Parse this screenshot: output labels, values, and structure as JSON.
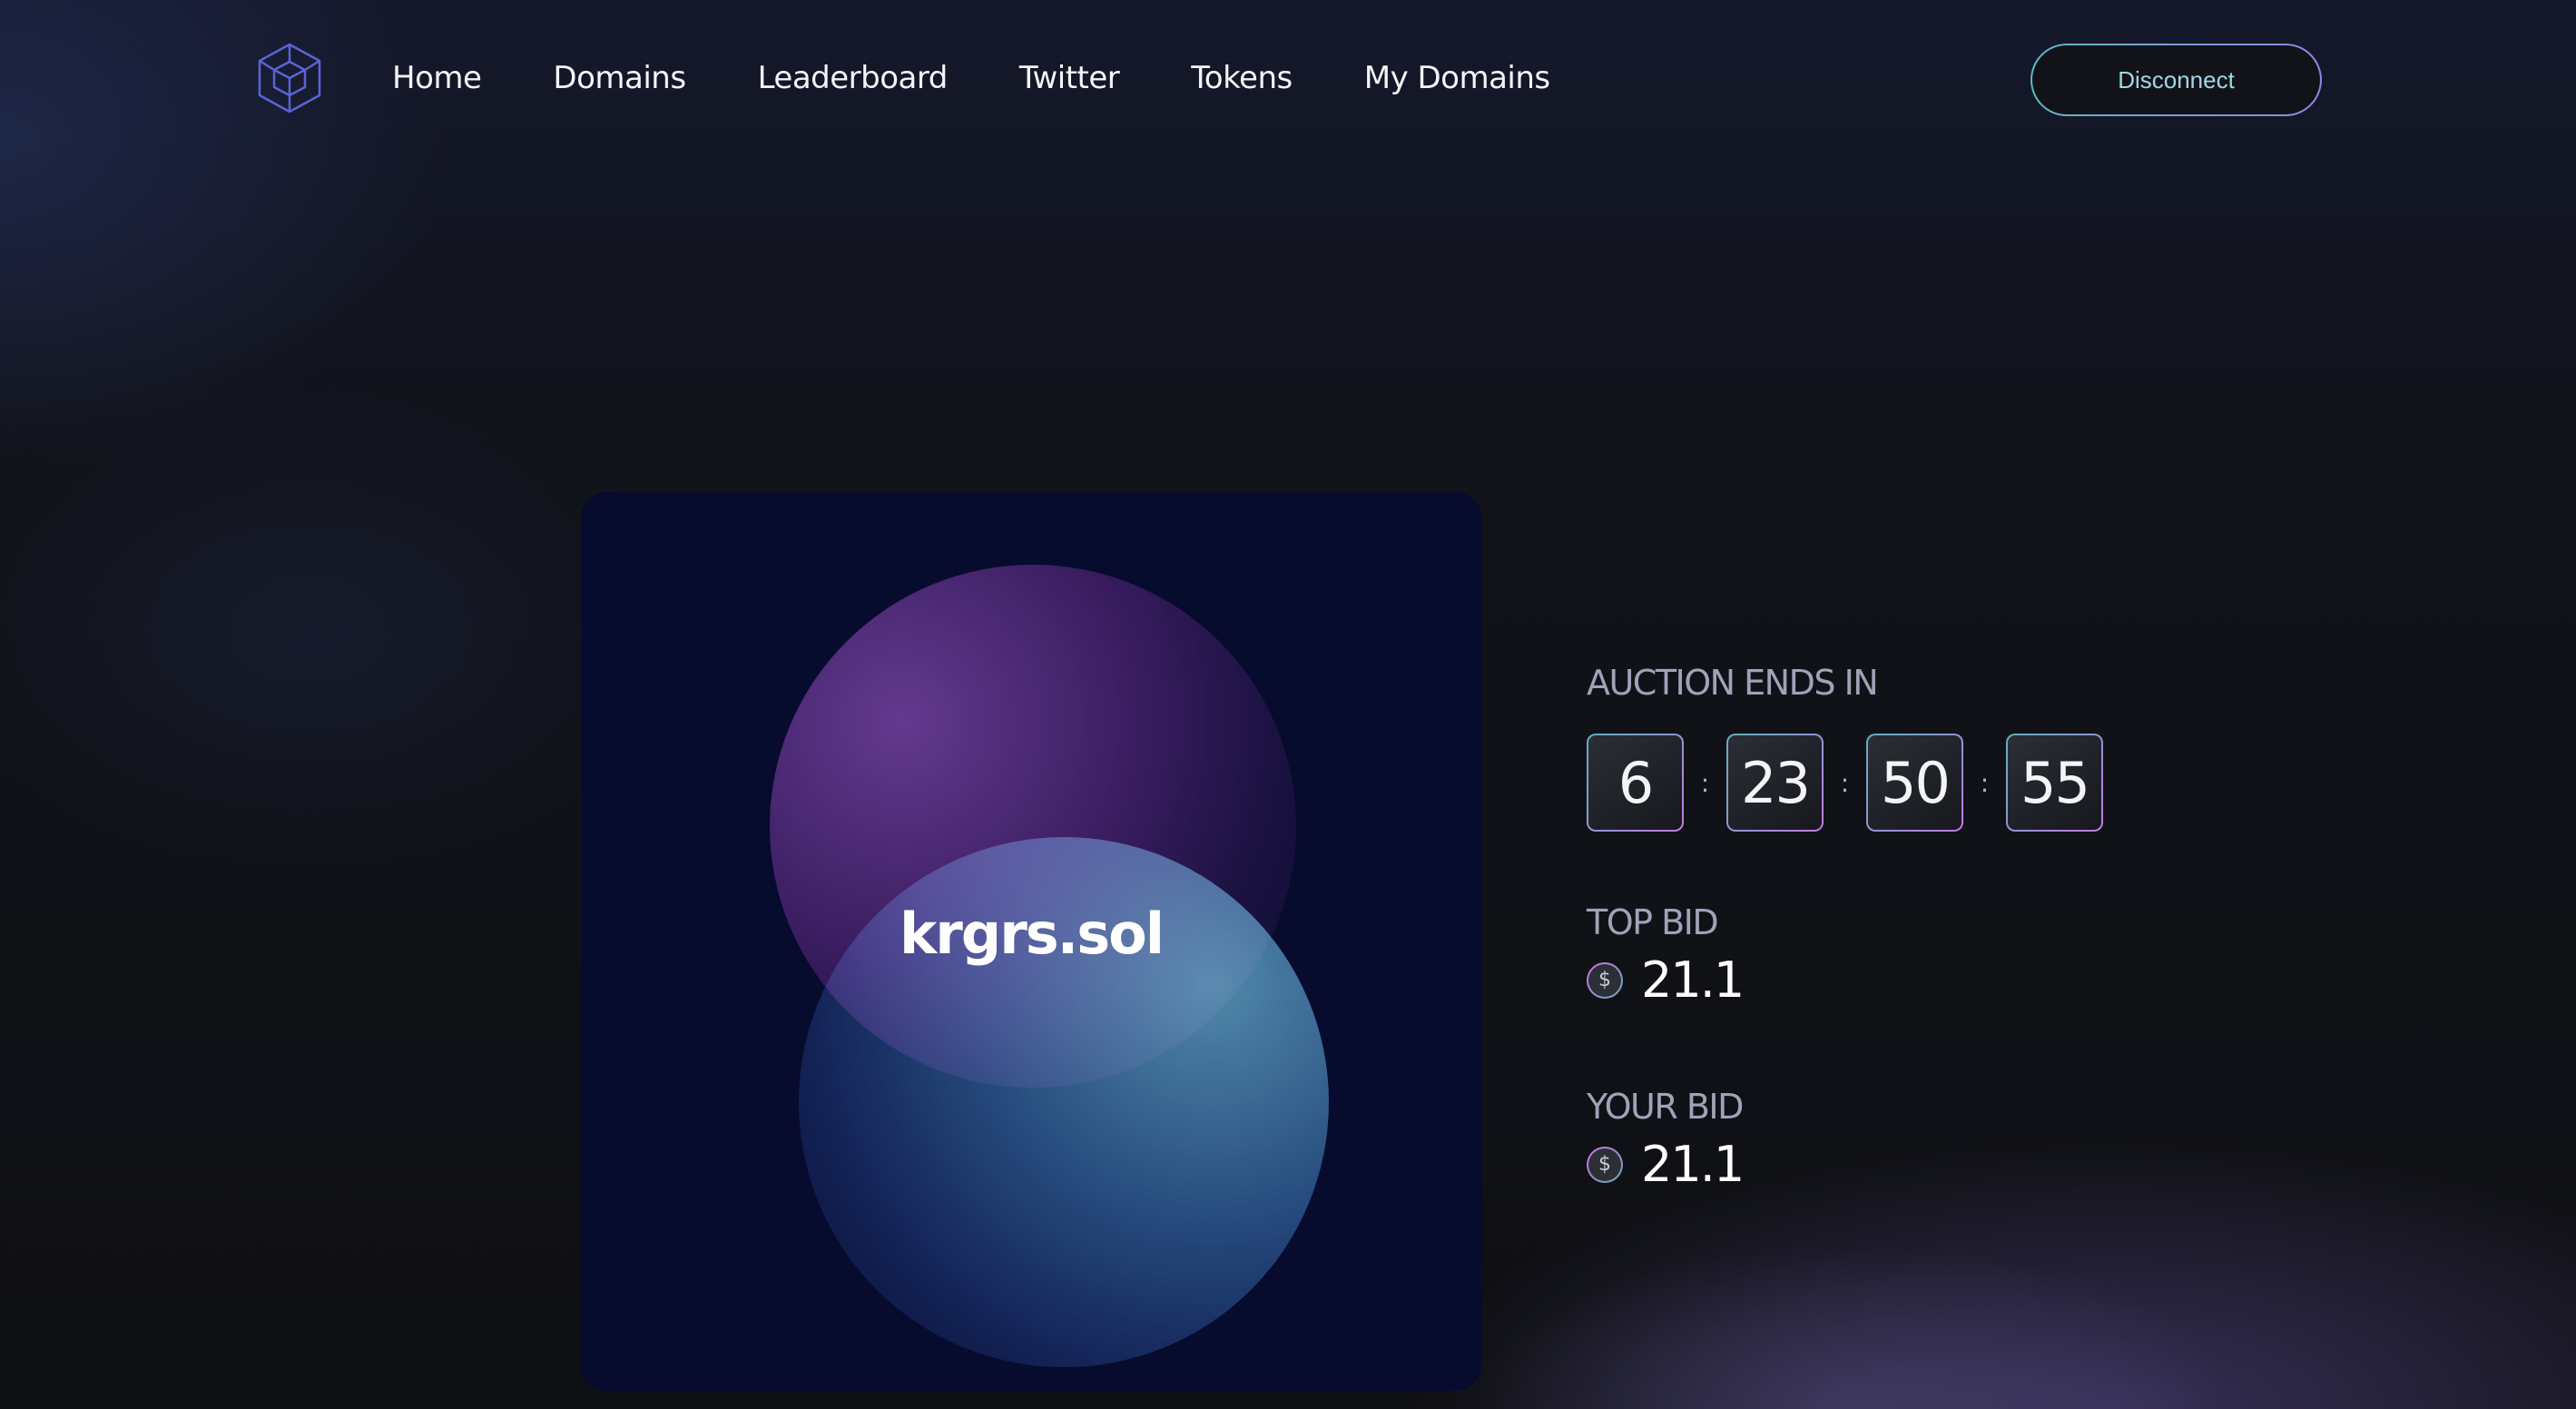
{
  "nav": {
    "logo_icon": "cube-icon",
    "links": [
      {
        "label": "Home"
      },
      {
        "label": "Domains"
      },
      {
        "label": "Leaderboard"
      },
      {
        "label": "Twitter"
      },
      {
        "label": "Tokens"
      },
      {
        "label": "My Domains"
      }
    ],
    "disconnect_label": "Disconnect"
  },
  "card": {
    "domain": "krgrs.sol"
  },
  "auction": {
    "ends_label": "AUCTION ENDS IN",
    "countdown": [
      "6",
      "23",
      "50",
      "55"
    ],
    "separator": ":",
    "top_bid_label": "TOP BID",
    "top_bid_value": "21.1",
    "your_bid_label": "YOUR BID",
    "your_bid_value": "21.1",
    "currency_icon": "usdc-coin-icon",
    "currency_glyph": "$"
  },
  "colors": {
    "background": "#0f1014",
    "card": "#070b2d",
    "accent_teal": "#5fb6c6",
    "accent_purple": "#8f86e6",
    "label_gray": "#9fa3b8"
  }
}
